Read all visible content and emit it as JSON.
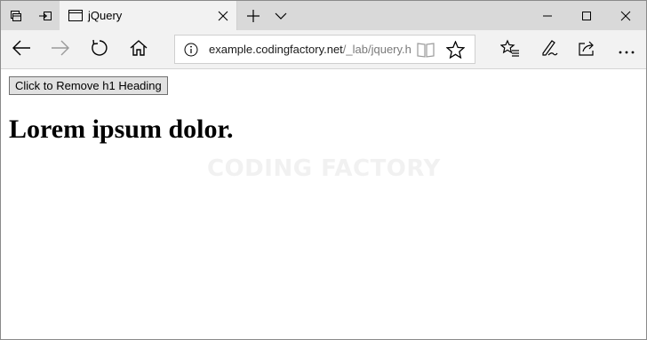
{
  "titlebar": {
    "tab_title": "jQuery",
    "icons": {
      "set_aside": "tabs-aside-icon",
      "restore": "tabs-restore-icon",
      "new_tab": "plus-icon",
      "tab_menu": "chevron-down-icon",
      "minimize": "minimize-icon",
      "maximize": "maximize-icon",
      "close": "close-icon"
    }
  },
  "toolbar": {
    "address_domain": "example.codingfactory.net",
    "address_path": "/_lab/jquery.ht",
    "icons": [
      "back-arrow-icon",
      "forward-arrow-icon",
      "refresh-icon",
      "home-icon",
      "info-icon",
      "reading-view-icon",
      "favorite-star-icon",
      "favorites-hub-icon",
      "pen-icon",
      "share-icon",
      "more-icon"
    ]
  },
  "page": {
    "button_label": "Click to Remove h1 Heading",
    "heading": "Lorem ipsum dolor.",
    "watermark": "CODING FACTORY"
  },
  "colors": {
    "titlebar_bg": "#d9d9d9",
    "toolbar_bg": "#f2f2f2",
    "content_bg": "#ffffff"
  }
}
